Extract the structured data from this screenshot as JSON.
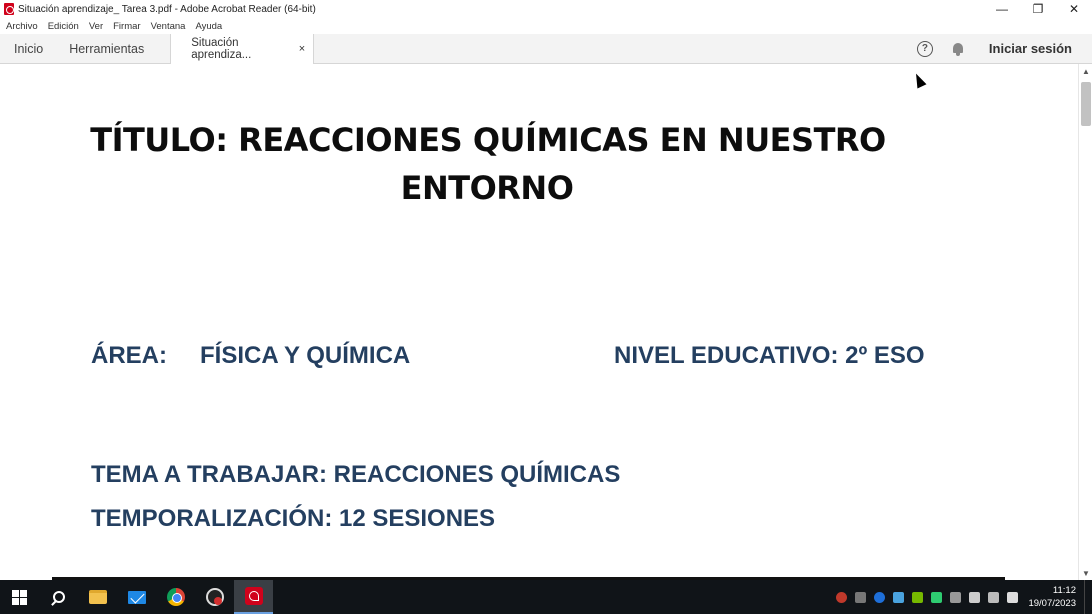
{
  "window": {
    "title": "Situación aprendizaje_ Tarea 3.pdf - Adobe Acrobat Reader (64-bit)",
    "minimize_glyph": "—",
    "restore_glyph": "❐",
    "close_glyph": "✕"
  },
  "menu": {
    "items": [
      "Archivo",
      "Edición",
      "Ver",
      "Firmar",
      "Ventana",
      "Ayuda"
    ]
  },
  "tabs": {
    "home": "Inicio",
    "tools": "Herramientas",
    "doc": "Situación aprendiza...",
    "doc_close": "×",
    "help_glyph": "?",
    "signin": "Iniciar sesión"
  },
  "document": {
    "title_line1": "TÍTULO: REACCIONES QUÍMICAS  EN NUESTRO",
    "title_line2": "ENTORNO",
    "area_label": "ÁREA:",
    "area_value": "FÍSICA Y QUÍMICA",
    "nivel": "NIVEL EDUCATIVO: 2º ESO",
    "tema": "TEMA A TRABAJAR: REACCIONES QUÍMICAS",
    "temporalizacion": "TEMPORALIZACIÓN: 12 SESIONES"
  },
  "scrollbar": {
    "up_glyph": "▲",
    "down_glyph": "▼"
  },
  "taskbar": {
    "time": "11:12",
    "date": "19/07/2023"
  }
}
